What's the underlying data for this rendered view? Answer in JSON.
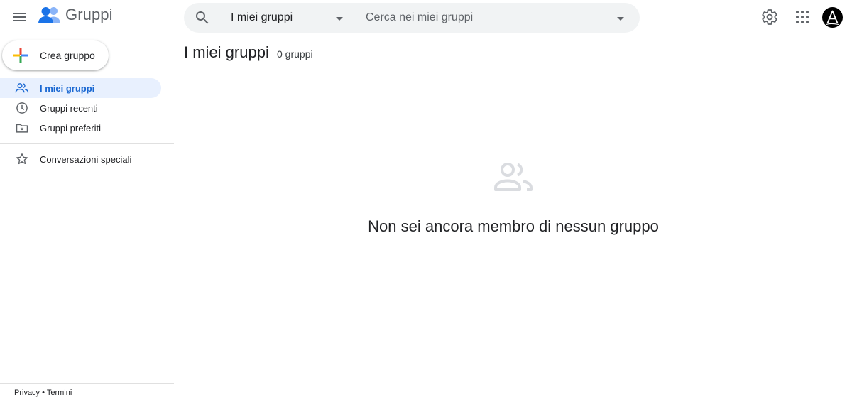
{
  "header": {
    "app_name": "Gruppi",
    "search_scope": "I miei gruppi",
    "search_placeholder": "Cerca nei miei gruppi",
    "avatar_letter": "A"
  },
  "sidebar": {
    "create_label": "Crea gruppo",
    "items": [
      {
        "label": "I miei gruppi",
        "icon": "people-icon",
        "active": true
      },
      {
        "label": "Gruppi recenti",
        "icon": "clock-icon",
        "active": false
      },
      {
        "label": "Gruppi preferiti",
        "icon": "star-folder-icon",
        "active": false
      }
    ],
    "secondary_items": [
      {
        "label": "Conversazioni speciali",
        "icon": "star-icon"
      }
    ],
    "footer": {
      "privacy": "Privacy",
      "separator": "•",
      "terms": "Termini"
    }
  },
  "main": {
    "title": "I miei gruppi",
    "count": "0 gruppi",
    "empty_message": "Non sei ancora membro di nessun gruppo"
  },
  "colors": {
    "accent": "#1967d2",
    "active_bg": "#e8f0fe",
    "search_bg": "#f1f3f4",
    "logo_blue_dark": "#1a73e8",
    "logo_blue_light": "#8ab4f8"
  }
}
